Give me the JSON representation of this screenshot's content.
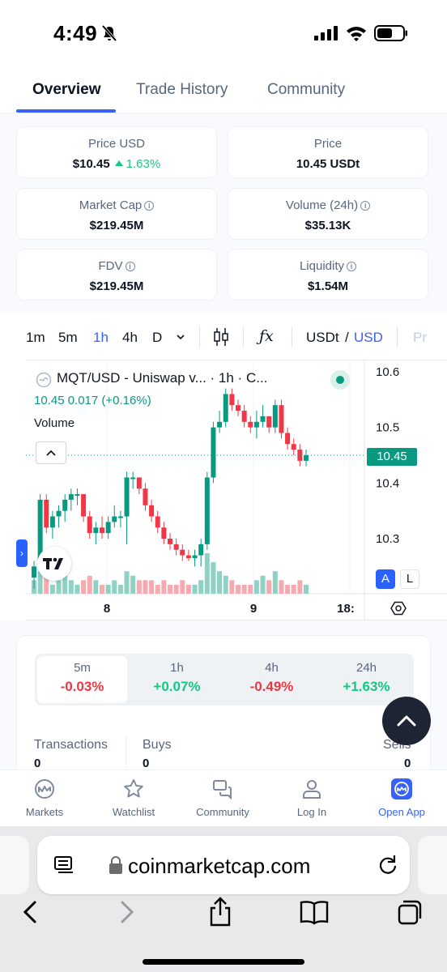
{
  "status_bar": {
    "time": "4:49"
  },
  "tabs": [
    {
      "label": "Overview",
      "active": true
    },
    {
      "label": "Trade History",
      "active": false
    },
    {
      "label": "Community",
      "active": false
    }
  ],
  "stats": {
    "price_usd": {
      "label": "Price USD",
      "value": "$10.45",
      "change": "1.63%"
    },
    "price": {
      "label": "Price",
      "value": "10.45 USDt"
    },
    "market_cap": {
      "label": "Market Cap",
      "value": "$219.45M"
    },
    "volume": {
      "label": "Volume (24h)",
      "value": "$35.13K"
    },
    "fdv": {
      "label": "FDV",
      "value": "$219.45M"
    },
    "liquidity": {
      "label": "Liquidity",
      "value": "$1.54M"
    }
  },
  "toolbar": {
    "intervals": [
      "1m",
      "5m",
      "1h",
      "4h",
      "D"
    ],
    "active_interval": "1h",
    "fx_label": "ƒx",
    "quote_a": "USDt",
    "slash": "/",
    "quote_b": "USD",
    "more": "Pr"
  },
  "chart": {
    "legend_title": "MQT/USD - Uniswap v...  · 1h · C...",
    "legend_values": "10.45  0.017 (+0.16%)",
    "volume_label": "Volume",
    "price_tag": "10.45",
    "btn_a": "A",
    "btn_l": "L",
    "colors": {
      "up": "#089981",
      "down": "#f23645",
      "up_vol": "#8fd1c4",
      "down_vol": "#f7a9b0"
    }
  },
  "chart_data": {
    "type": "candlestick",
    "title": "MQT/USD - Uniswap v... · 1h · C...",
    "interval": "1h",
    "y_ticks": [
      "10.6",
      "10.5",
      "10.4",
      "10.3"
    ],
    "x_ticks": [
      "8",
      "9",
      "18:"
    ],
    "ylim": [
      10.21,
      10.63
    ],
    "last_price": 10.45,
    "candles": [
      {
        "o": 10.23,
        "h": 10.26,
        "l": 10.21,
        "c": 10.25
      },
      {
        "o": 10.25,
        "h": 10.38,
        "l": 10.24,
        "c": 10.37
      },
      {
        "o": 10.37,
        "h": 10.38,
        "l": 10.31,
        "c": 10.32
      },
      {
        "o": 10.32,
        "h": 10.35,
        "l": 10.3,
        "c": 10.34
      },
      {
        "o": 10.34,
        "h": 10.36,
        "l": 10.32,
        "c": 10.35
      },
      {
        "o": 10.35,
        "h": 10.38,
        "l": 10.33,
        "c": 10.37
      },
      {
        "o": 10.37,
        "h": 10.39,
        "l": 10.35,
        "c": 10.38
      },
      {
        "o": 10.38,
        "h": 10.39,
        "l": 10.36,
        "c": 10.38
      },
      {
        "o": 10.38,
        "h": 10.38,
        "l": 10.33,
        "c": 10.34
      },
      {
        "o": 10.34,
        "h": 10.35,
        "l": 10.3,
        "c": 10.31
      },
      {
        "o": 10.31,
        "h": 10.33,
        "l": 10.29,
        "c": 10.32
      },
      {
        "o": 10.32,
        "h": 10.34,
        "l": 10.3,
        "c": 10.31
      },
      {
        "o": 10.31,
        "h": 10.34,
        "l": 10.3,
        "c": 10.33
      },
      {
        "o": 10.33,
        "h": 10.36,
        "l": 10.32,
        "c": 10.34
      },
      {
        "o": 10.34,
        "h": 10.35,
        "l": 10.32,
        "c": 10.34
      },
      {
        "o": 10.34,
        "h": 10.42,
        "l": 10.29,
        "c": 10.41
      },
      {
        "o": 10.41,
        "h": 10.42,
        "l": 10.39,
        "c": 10.41
      },
      {
        "o": 10.41,
        "h": 10.41,
        "l": 10.38,
        "c": 10.39
      },
      {
        "o": 10.39,
        "h": 10.4,
        "l": 10.35,
        "c": 10.36
      },
      {
        "o": 10.36,
        "h": 10.37,
        "l": 10.33,
        "c": 10.34
      },
      {
        "o": 10.34,
        "h": 10.35,
        "l": 10.31,
        "c": 10.32
      },
      {
        "o": 10.32,
        "h": 10.33,
        "l": 10.29,
        "c": 10.3
      },
      {
        "o": 10.3,
        "h": 10.31,
        "l": 10.28,
        "c": 10.29
      },
      {
        "o": 10.29,
        "h": 10.3,
        "l": 10.27,
        "c": 10.28
      },
      {
        "o": 10.28,
        "h": 10.29,
        "l": 10.26,
        "c": 10.27
      },
      {
        "o": 10.27,
        "h": 10.28,
        "l": 10.26,
        "c": 10.265
      },
      {
        "o": 10.265,
        "h": 10.28,
        "l": 10.25,
        "c": 10.27
      },
      {
        "o": 10.27,
        "h": 10.3,
        "l": 10.25,
        "c": 10.29
      },
      {
        "o": 10.29,
        "h": 10.42,
        "l": 10.28,
        "c": 10.41
      },
      {
        "o": 10.41,
        "h": 10.51,
        "l": 10.4,
        "c": 10.5
      },
      {
        "o": 10.5,
        "h": 10.53,
        "l": 10.49,
        "c": 10.51
      },
      {
        "o": 10.51,
        "h": 10.57,
        "l": 10.5,
        "c": 10.56
      },
      {
        "o": 10.56,
        "h": 10.57,
        "l": 10.53,
        "c": 10.54
      },
      {
        "o": 10.54,
        "h": 10.55,
        "l": 10.52,
        "c": 10.53
      },
      {
        "o": 10.53,
        "h": 10.54,
        "l": 10.5,
        "c": 10.51
      },
      {
        "o": 10.51,
        "h": 10.52,
        "l": 10.49,
        "c": 10.5
      },
      {
        "o": 10.5,
        "h": 10.53,
        "l": 10.48,
        "c": 10.51
      },
      {
        "o": 10.51,
        "h": 10.54,
        "l": 10.5,
        "c": 10.52
      },
      {
        "o": 10.52,
        "h": 10.52,
        "l": 10.49,
        "c": 10.5
      },
      {
        "o": 10.5,
        "h": 10.55,
        "l": 10.49,
        "c": 10.54
      },
      {
        "o": 10.54,
        "h": 10.55,
        "l": 10.48,
        "c": 10.49
      },
      {
        "o": 10.49,
        "h": 10.5,
        "l": 10.46,
        "c": 10.47
      },
      {
        "o": 10.47,
        "h": 10.48,
        "l": 10.45,
        "c": 10.46
      },
      {
        "o": 10.46,
        "h": 10.47,
        "l": 10.43,
        "c": 10.44
      },
      {
        "o": 10.44,
        "h": 10.46,
        "l": 10.43,
        "c": 10.45
      }
    ],
    "volumes": [
      3,
      5,
      4,
      2,
      3,
      4,
      3,
      2,
      3,
      4,
      3,
      2,
      2,
      3,
      2,
      5,
      4,
      3,
      3,
      3,
      2,
      3,
      2,
      2,
      3,
      2,
      2,
      3,
      9,
      7,
      5,
      4,
      3,
      2,
      2,
      2,
      3,
      4,
      3,
      5,
      3,
      2,
      2,
      3,
      2
    ]
  },
  "changes": [
    {
      "period": "5m",
      "value": "-0.03%",
      "dir": "down",
      "selected": true
    },
    {
      "period": "1h",
      "value": "+0.07%",
      "dir": "up",
      "selected": false
    },
    {
      "period": "4h",
      "value": "-0.49%",
      "dir": "down",
      "selected": false
    },
    {
      "period": "24h",
      "value": "+1.63%",
      "dir": "up",
      "selected": false
    }
  ],
  "transactions": {
    "transactions_label": "Transactions",
    "transactions_value": "0",
    "buys_label": "Buys",
    "buys_value": "0",
    "sells_label": "Sells",
    "sells_value": "0"
  },
  "bottom_nav": [
    {
      "label": "Markets",
      "icon": "cmc-logo-icon"
    },
    {
      "label": "Watchlist",
      "icon": "star-icon"
    },
    {
      "label": "Community",
      "icon": "chat-bubbles-icon"
    },
    {
      "label": "Log In",
      "icon": "person-icon"
    },
    {
      "label": "Open App",
      "icon": "app-icon"
    }
  ],
  "browser": {
    "url": "coinmarketcap.com"
  },
  "colors": {
    "accent": "#3861fb",
    "green": "#16c784",
    "red": "#ea3943"
  }
}
